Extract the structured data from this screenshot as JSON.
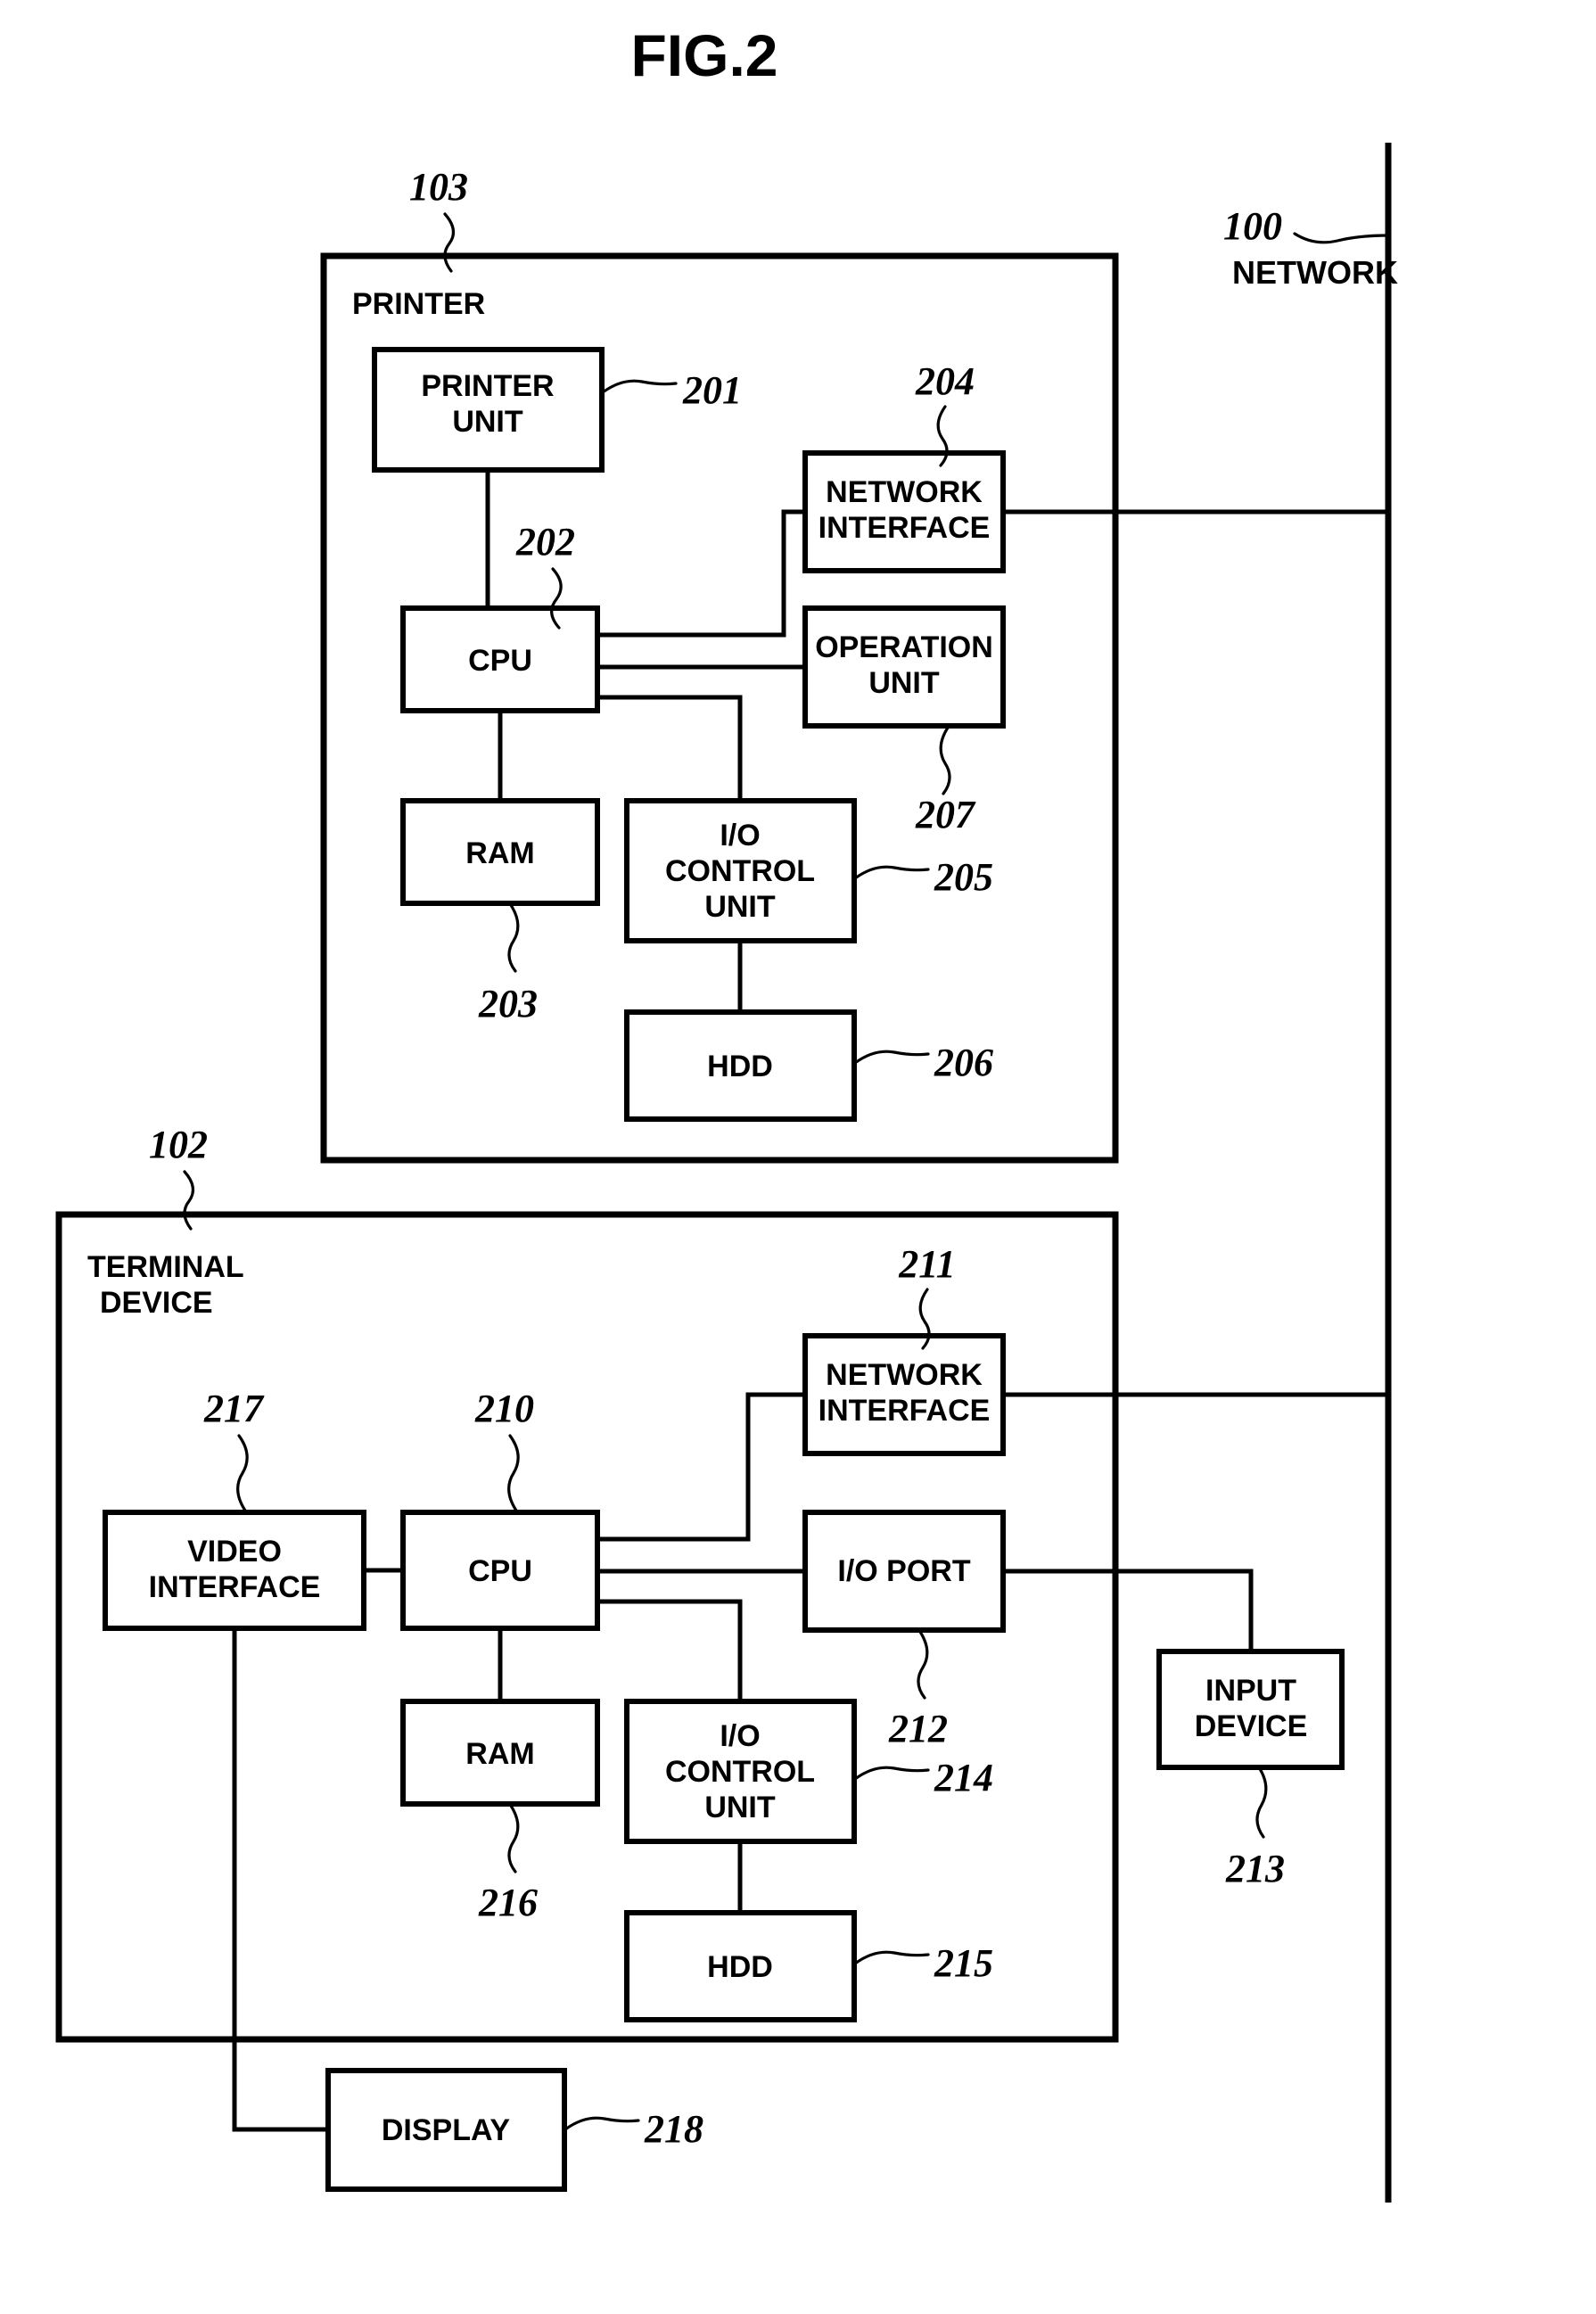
{
  "figure": {
    "title": "FIG.2"
  },
  "network": {
    "ref": "100",
    "label": "NETWORK"
  },
  "printer": {
    "ref": "103",
    "label": "PRINTER",
    "blocks": {
      "printer_unit": {
        "label_line1": "PRINTER",
        "label_line2": "UNIT",
        "ref": "201"
      },
      "cpu": {
        "label": "CPU",
        "ref": "202"
      },
      "ram": {
        "label": "RAM",
        "ref": "203"
      },
      "network_interface": {
        "label_line1": "NETWORK",
        "label_line2": "INTERFACE",
        "ref": "204"
      },
      "operation_unit": {
        "label_line1": "OPERATION",
        "label_line2": "UNIT",
        "ref": "207"
      },
      "io_control_unit": {
        "label_line1": "I/O",
        "label_line2": "CONTROL",
        "label_line3": "UNIT",
        "ref": "205"
      },
      "hdd": {
        "label": "HDD",
        "ref": "206"
      }
    }
  },
  "terminal": {
    "ref": "102",
    "label_line1": "TERMINAL",
    "label_line2": "DEVICE",
    "blocks": {
      "video_interface": {
        "label_line1": "VIDEO",
        "label_line2": "INTERFACE",
        "ref": "217"
      },
      "cpu": {
        "label": "CPU",
        "ref": "210"
      },
      "ram": {
        "label": "RAM",
        "ref": "216"
      },
      "network_interface": {
        "label_line1": "NETWORK",
        "label_line2": "INTERFACE",
        "ref": "211"
      },
      "io_port": {
        "label": "I/O PORT",
        "ref": "212"
      },
      "io_control_unit": {
        "label_line1": "I/O",
        "label_line2": "CONTROL",
        "label_line3": "UNIT",
        "ref": "214"
      },
      "hdd": {
        "label": "HDD",
        "ref": "215"
      }
    }
  },
  "peripherals": {
    "input_device": {
      "label_line1": "INPUT",
      "label_line2": "DEVICE",
      "ref": "213"
    },
    "display": {
      "label": "DISPLAY",
      "ref": "218"
    }
  },
  "colors": {
    "ink": "#000000",
    "paper": "#ffffff"
  }
}
